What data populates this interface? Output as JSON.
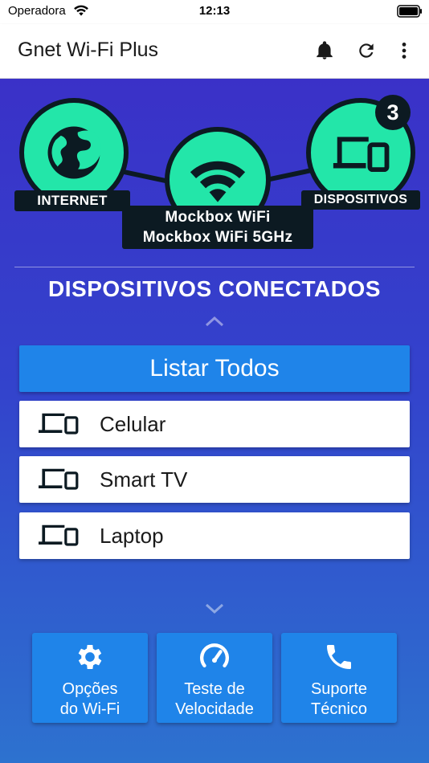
{
  "status_bar": {
    "carrier": "Operadora",
    "time": "12:13"
  },
  "app_bar": {
    "title": "Gnet Wi-Fi Plus",
    "icons": [
      "bell-icon",
      "refresh-icon",
      "more-vert-icon"
    ]
  },
  "topology": {
    "internet_label": "INTERNET",
    "wifi_label_1": "Mockbox WiFi",
    "wifi_label_2": "Mockbox WiFi 5GHz",
    "devices_label": "DISPOSITIVOS",
    "device_count": "3",
    "icons": [
      "globe-icon",
      "wifi-icon",
      "devices-icon"
    ]
  },
  "connected": {
    "title": "DISPOSITIVOS CONECTADOS",
    "list_all_label": "Listar Todos",
    "devices": [
      {
        "label": "Celular"
      },
      {
        "label": "Smart TV"
      },
      {
        "label": "Laptop"
      }
    ]
  },
  "actions": {
    "wifi_options_line1": "Opções",
    "wifi_options_line2": "do Wi-Fi",
    "speed_test_line1": "Teste de",
    "speed_test_line2": "Velocidade",
    "support_line1": "Suporte",
    "support_line2": "Técnico",
    "icons": [
      "gear-icon",
      "speedometer-icon",
      "phone-icon"
    ]
  },
  "colors": {
    "accent_green": "#23e6a9",
    "button_blue": "#1f84e9",
    "dark": "#0c1a22"
  }
}
